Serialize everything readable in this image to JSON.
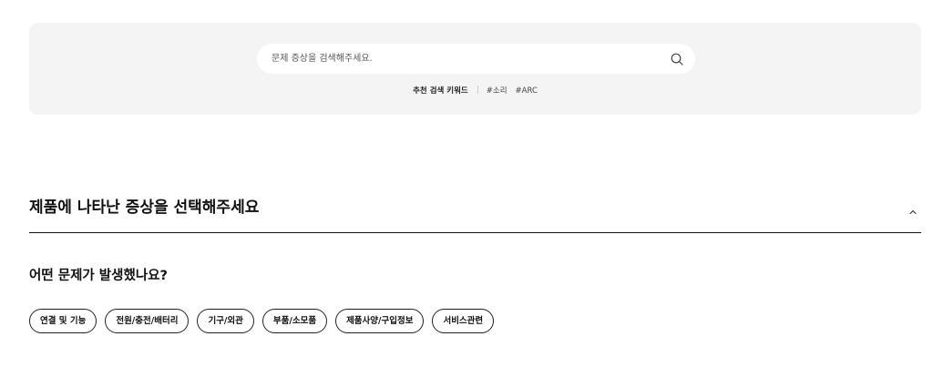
{
  "search": {
    "placeholder": "문제 증상을 검색해주세요.",
    "keywords_label": "추천 검색 키워드",
    "keywords": [
      "#소리",
      "#ARC"
    ]
  },
  "symptom_section": {
    "title": "제품에 나타난 증상을 선택해주세요",
    "collapse_icon": "chevron-up-icon",
    "question": "어떤 문제가 발생했나요?",
    "categories": [
      "연결 및 기능",
      "전원/충전/배터리",
      "기구/외관",
      "부품/소모품",
      "제품사양/구입정보",
      "서비스관련"
    ]
  }
}
